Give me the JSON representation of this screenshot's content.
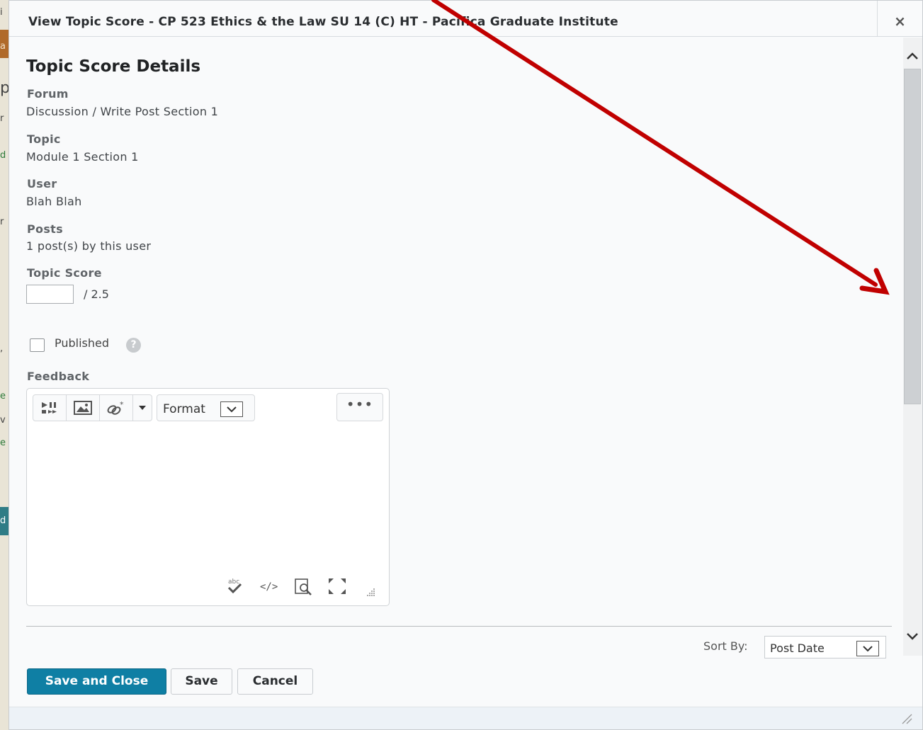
{
  "dialog": {
    "title": "View Topic Score - CP 523 Ethics & the Law SU 14 (C) HT - Pacifica Graduate Institute",
    "close_label": "×"
  },
  "details": {
    "heading": "Topic Score Details",
    "forum_label": "Forum",
    "forum_value": "Discussion / Write Post Section 1",
    "topic_label": "Topic",
    "topic_value": "Module 1 Section 1",
    "user_label": "User",
    "user_value": "Blah Blah",
    "posts_label": "Posts",
    "posts_value": "1 post(s) by this user",
    "score_label": "Topic Score",
    "score_value": "",
    "score_max": "/ 2.5"
  },
  "published": {
    "label": "Published",
    "checked": false,
    "help_glyph": "?"
  },
  "feedback": {
    "label": "Feedback",
    "toolbar": {
      "format_label": "Format",
      "more_label": "•••",
      "icons": [
        "insert-stuff-icon",
        "insert-image-icon",
        "insert-link-icon",
        "dropdown-caret-icon"
      ],
      "bottom_icons": [
        "spellcheck-icon",
        "source-code-icon",
        "preview-icon",
        "fullscreen-icon",
        "resize-grip-icon"
      ]
    }
  },
  "sort": {
    "label": "Sort By:",
    "selected": "Post Date"
  },
  "buttons": {
    "save_close": "Save and Close",
    "save": "Save",
    "cancel": "Cancel"
  },
  "background": {
    "edge_letters": [
      "i",
      "a",
      "p",
      "r",
      "d",
      "r",
      ",",
      "e",
      "v",
      "e",
      "d"
    ]
  },
  "colors": {
    "primary_button": "#0f7fa4",
    "annotation_arrow": "#c00000"
  }
}
